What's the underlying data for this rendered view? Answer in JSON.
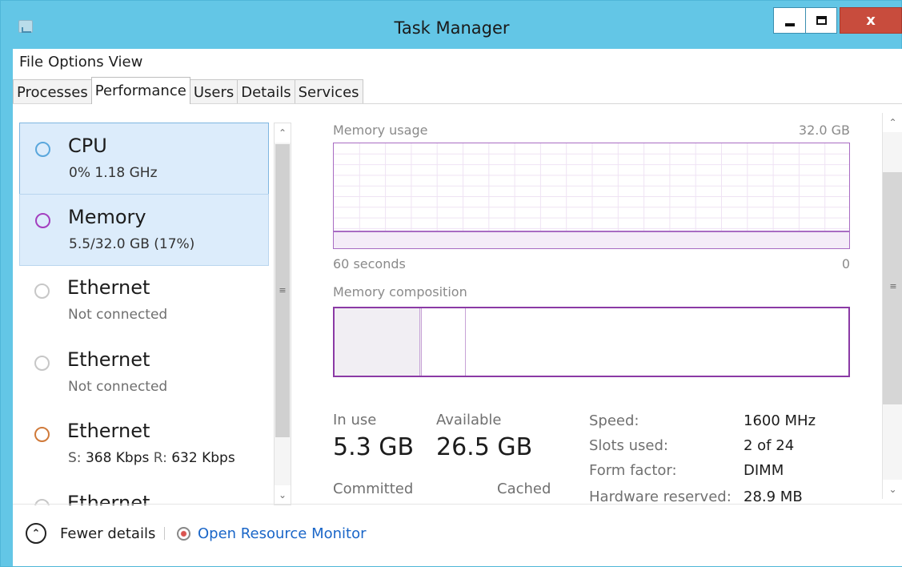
{
  "window": {
    "title": "Task Manager",
    "close_label": "x"
  },
  "menu": [
    "File",
    "Options",
    "View"
  ],
  "tabs": [
    {
      "label": "Processes",
      "active": false
    },
    {
      "label": "Performance",
      "active": true
    },
    {
      "label": "Users",
      "active": false
    },
    {
      "label": "Details",
      "active": false
    },
    {
      "label": "Services",
      "active": false
    }
  ],
  "resources": [
    {
      "title": "CPU",
      "subtitle": "0% 1.18 GHz",
      "state": "selected-cpu"
    },
    {
      "title": "Memory",
      "subtitle": "5.5/32.0 GB (17%)",
      "state": "selected-memory"
    },
    {
      "title": "Ethernet",
      "subtitle": "Not connected",
      "state": "inactive"
    },
    {
      "title": "Ethernet",
      "subtitle": "Not connected",
      "state": "inactive"
    },
    {
      "title": "Ethernet",
      "send_label": "S:",
      "send_value": "368 Kbps",
      "recv_label": "R:",
      "recv_value": "632 Kbps",
      "state": "active"
    },
    {
      "title": "Ethernet",
      "subtitle": "",
      "state": "inactive"
    }
  ],
  "memory_panel": {
    "usage_label": "Memory usage",
    "usage_max": "32.0 GB",
    "usage_fraction": 0.17,
    "axis_left": "60 seconds",
    "axis_right": "0",
    "composition_label": "Memory composition",
    "composition": {
      "in_use_fraction": 0.17,
      "modified_fraction": 0.085
    },
    "in_use_label": "In use",
    "in_use_value": "5.3 GB",
    "available_label": "Available",
    "available_value": "26.5 GB",
    "committed_label": "Committed",
    "cached_label": "Cached",
    "specs": [
      {
        "label": "Speed:",
        "value": "1600 MHz"
      },
      {
        "label": "Slots used:",
        "value": "2 of 24"
      },
      {
        "label": "Form factor:",
        "value": "DIMM"
      },
      {
        "label": "Hardware reserved:",
        "value": "28.9 MB"
      }
    ]
  },
  "footer": {
    "fewer_details": "Fewer details",
    "open_monitor": "Open Resource Monitor"
  },
  "colors": {
    "titlebar": "#63c6e6",
    "memory_accent": "#8b3aa5",
    "cpu_accent": "#5aa7dc",
    "link": "#1a66c8"
  }
}
